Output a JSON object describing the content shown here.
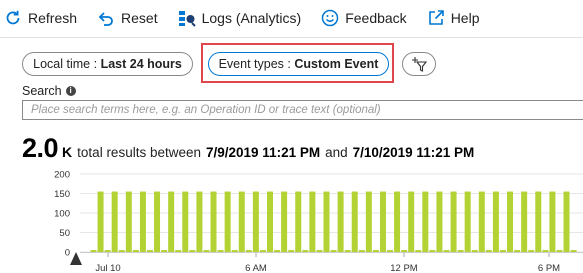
{
  "toolbar": {
    "refresh": {
      "label": "Refresh",
      "icon": "refresh-icon"
    },
    "reset": {
      "label": "Reset",
      "icon": "undo-icon"
    },
    "logs": {
      "label": "Logs (Analytics)",
      "icon": "logs-icon"
    },
    "feedback": {
      "label": "Feedback",
      "icon": "smiley-icon"
    },
    "help": {
      "label": "Help",
      "icon": "external-link-icon"
    }
  },
  "filters": {
    "time": {
      "prefix": "Local time :",
      "value": "Last 24 hours"
    },
    "event": {
      "prefix": "Event types :",
      "value": "Custom Event"
    },
    "add_filter_icon": "add-filter-icon"
  },
  "search": {
    "label": "Search",
    "placeholder": "Place search terms here, e.g. an Operation ID or trace text (optional)"
  },
  "summary": {
    "count": "2.0",
    "unit": "K",
    "text": "total results between",
    "start": "7/9/2019 11:21 PM",
    "and": "and",
    "end": "7/10/2019 11:21 PM"
  },
  "colors": {
    "accent": "#0078d4",
    "bar": "#b3d233",
    "highlight": "#e0474c"
  },
  "chart_data": {
    "type": "bar",
    "ylim": [
      0,
      200
    ],
    "yticks": [
      0,
      50,
      100,
      150,
      200
    ],
    "grid": true,
    "x_tick_labels": [
      "Jul 10",
      "6 AM",
      "12 PM",
      "6 PM"
    ],
    "values": [
      5,
      155,
      5,
      155,
      5,
      155,
      5,
      155,
      5,
      155,
      5,
      155,
      5,
      155,
      5,
      155,
      5,
      155,
      5,
      155,
      5,
      155,
      5,
      155,
      5,
      155,
      5,
      155,
      5,
      155,
      5,
      155,
      5,
      155,
      5,
      155,
      5,
      155,
      5,
      155,
      5,
      155,
      5,
      155,
      5,
      155,
      5,
      155,
      5,
      155,
      5,
      155,
      5,
      155,
      5,
      155,
      5,
      155,
      5,
      155,
      5,
      155,
      5,
      155,
      5,
      155,
      5,
      155,
      5
    ]
  }
}
